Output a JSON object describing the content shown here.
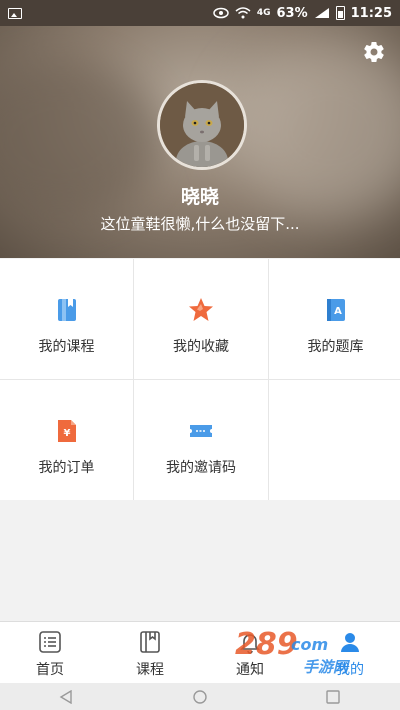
{
  "statusbar": {
    "battery_percent": "63%",
    "network": "4G",
    "time": "11:25"
  },
  "profile": {
    "name": "晓晓",
    "bio": "这位童鞋很懒,什么也没留下..."
  },
  "menu": [
    {
      "label": "我的课程",
      "icon": "book-icon",
      "color": "#4a9be8"
    },
    {
      "label": "我的收藏",
      "icon": "star-icon",
      "color": "#ef6a3d"
    },
    {
      "label": "我的题库",
      "icon": "question-bank-icon",
      "color": "#4a9be8"
    },
    {
      "label": "我的订单",
      "icon": "order-icon",
      "color": "#ef6a3d"
    },
    {
      "label": "我的邀请码",
      "icon": "ticket-icon",
      "color": "#4a9be8"
    }
  ],
  "bottom_nav": [
    {
      "label": "首页",
      "icon": "home-list-icon"
    },
    {
      "label": "课程",
      "icon": "course-book-icon"
    },
    {
      "label": "通知",
      "icon": "bell-icon"
    },
    {
      "label": "我的",
      "icon": "user-icon",
      "active": true
    }
  ],
  "watermark": {
    "digits": "289",
    "suffix": "com",
    "text": "手游网"
  },
  "colors": {
    "accent_blue": "#4a9be8",
    "accent_orange": "#ef6a3d",
    "active_tab": "#2a8ae8"
  }
}
